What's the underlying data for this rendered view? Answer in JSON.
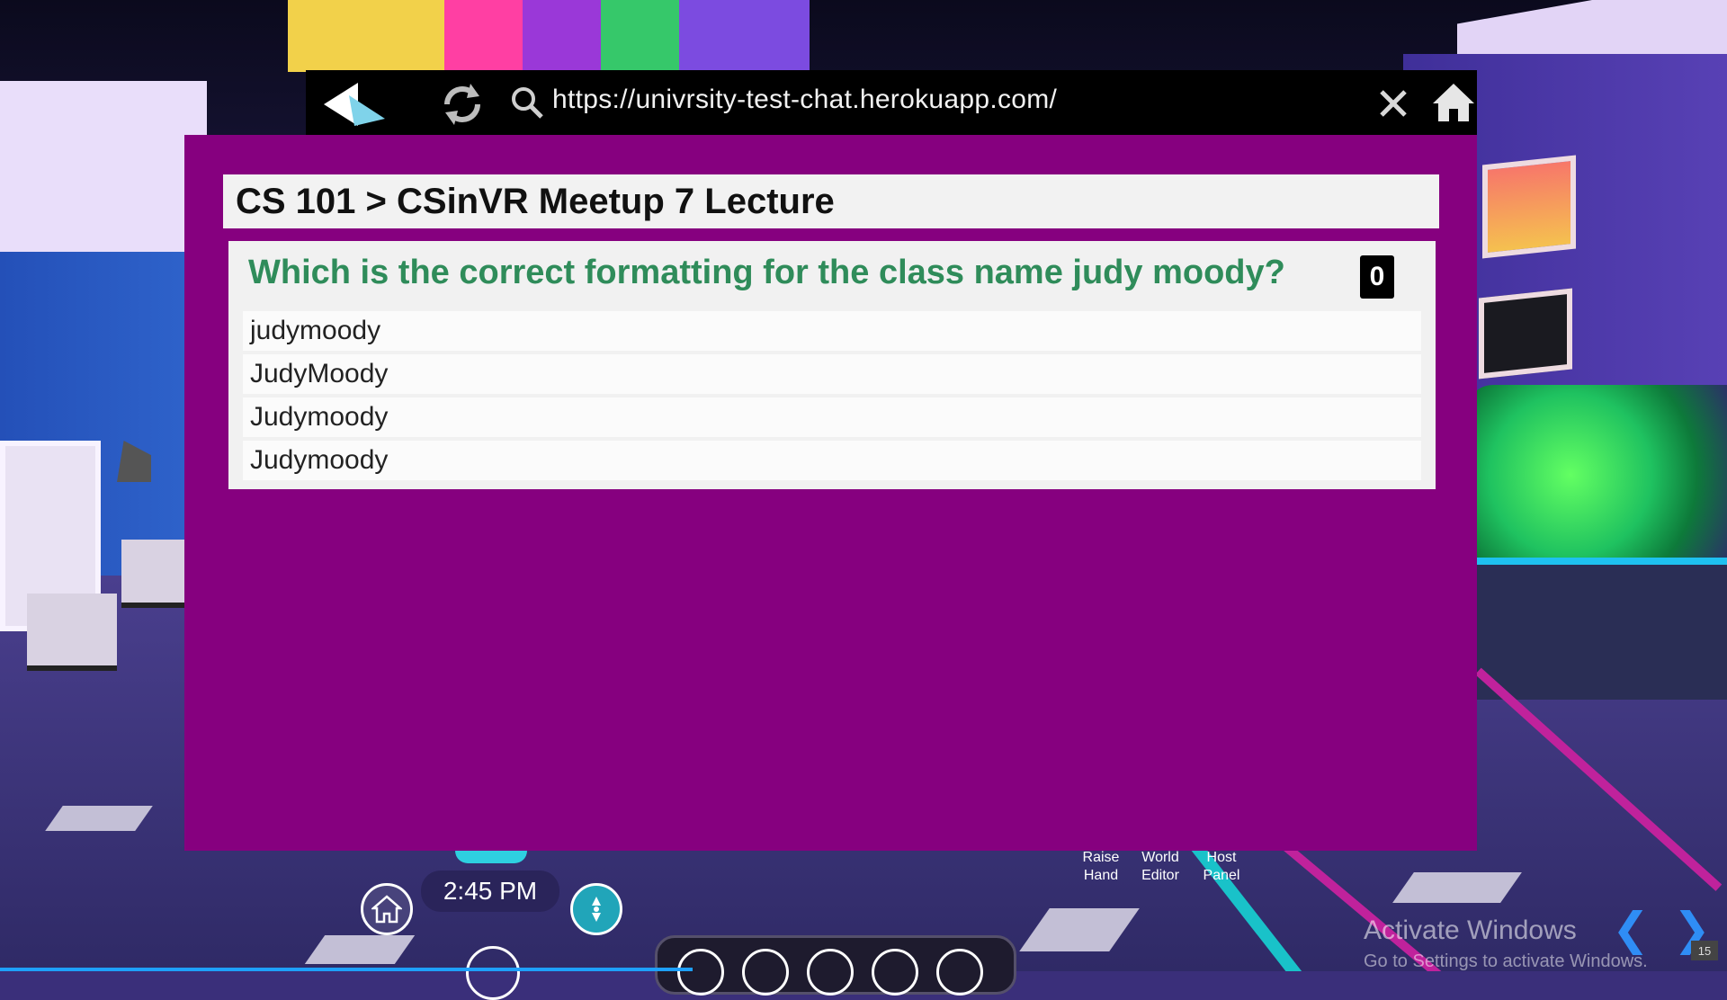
{
  "browser": {
    "url": "https://univrsity-test-chat.herokuapp.com/"
  },
  "page": {
    "breadcrumb": "CS 101 > CSinVR Meetup 7 Lecture",
    "question": "Which is the correct formatting for the class name judy moody?",
    "count": "0",
    "options": [
      "judymoody",
      "JudyMoody",
      "Judymoody",
      "Judymoody"
    ]
  },
  "hud": {
    "time": "2:45 PM",
    "raise_hand": "Raise\nHand",
    "world_editor": "World\nEditor",
    "host_panel": "Host\nPanel"
  },
  "os": {
    "activate_title": "Activate Windows",
    "activate_sub": "Go to Settings to activate Windows.",
    "corner_number": "15"
  },
  "colors": {
    "panel_bg": "#86007f",
    "question_text": "#2f8c5a",
    "accent_teal": "#21a5b9"
  },
  "icons": [
    "back-icon",
    "refresh-icon",
    "search-icon",
    "close-icon",
    "home-icon",
    "compass-icon"
  ]
}
